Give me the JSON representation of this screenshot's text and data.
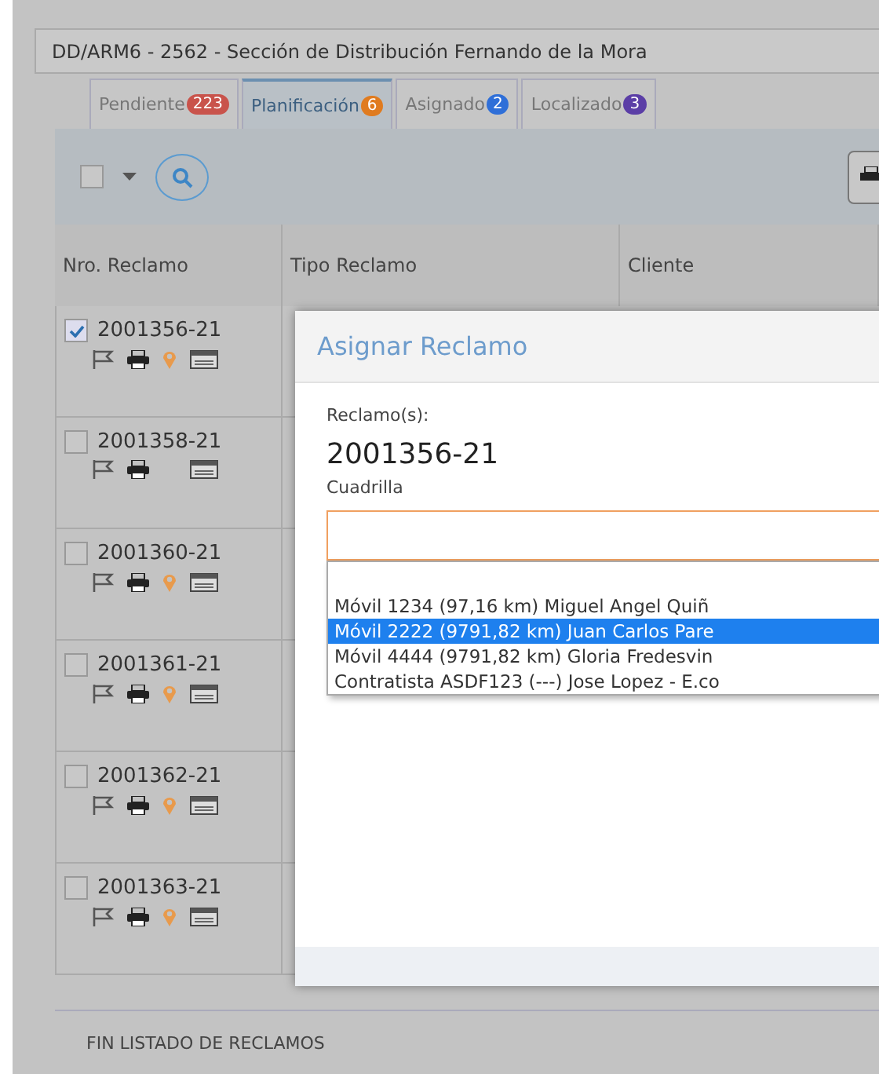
{
  "header": {
    "title": "DD/ARM6 - 2562 - Sección de Distribución Fernando de la Mora"
  },
  "tabs": [
    {
      "label": "Pendiente",
      "count": "223",
      "color": "#c9534b",
      "selected": false
    },
    {
      "label": "Planificación",
      "count": "6",
      "color": "#e07b1f",
      "selected": true
    },
    {
      "label": "Asignado",
      "count": "2",
      "color": "#2f6fd8",
      "selected": false
    },
    {
      "label": "Localizado",
      "count": "3",
      "color": "#5b3ea6",
      "selected": false
    }
  ],
  "toolbar": {
    "select_all_checked": false
  },
  "table": {
    "columns": [
      "Nro. Reclamo",
      "Tipo Reclamo",
      "Cliente"
    ],
    "rows": [
      {
        "number": "2001356-21",
        "checked": true,
        "located": true
      },
      {
        "number": "2001358-21",
        "checked": false,
        "located": false
      },
      {
        "number": "2001360-21",
        "checked": false,
        "located": true
      },
      {
        "number": "2001361-21",
        "checked": false,
        "located": true
      },
      {
        "number": "2001362-21",
        "checked": false,
        "located": true
      },
      {
        "number": "2001363-21",
        "checked": false,
        "located": true
      }
    ]
  },
  "footer": "FIN LISTADO DE RECLAMOS",
  "dialog": {
    "title": "Asignar Reclamo",
    "claims_label": "Reclamo(s):",
    "claims_value": "2001356-21",
    "crew_label": "Cuadrilla",
    "options": [
      {
        "label": "Móvil 1234 (97,16 km) Miguel Angel Quiñ",
        "selected": false
      },
      {
        "label": "Móvil 2222 (9791,82 km) Juan Carlos Pare",
        "selected": true
      },
      {
        "label": "Móvil 4444 (9791,82 km) Gloria Fredesvin",
        "selected": false
      },
      {
        "label": "Contratista ASDF123 (---) Jose Lopez - E.co",
        "selected": false
      }
    ]
  }
}
